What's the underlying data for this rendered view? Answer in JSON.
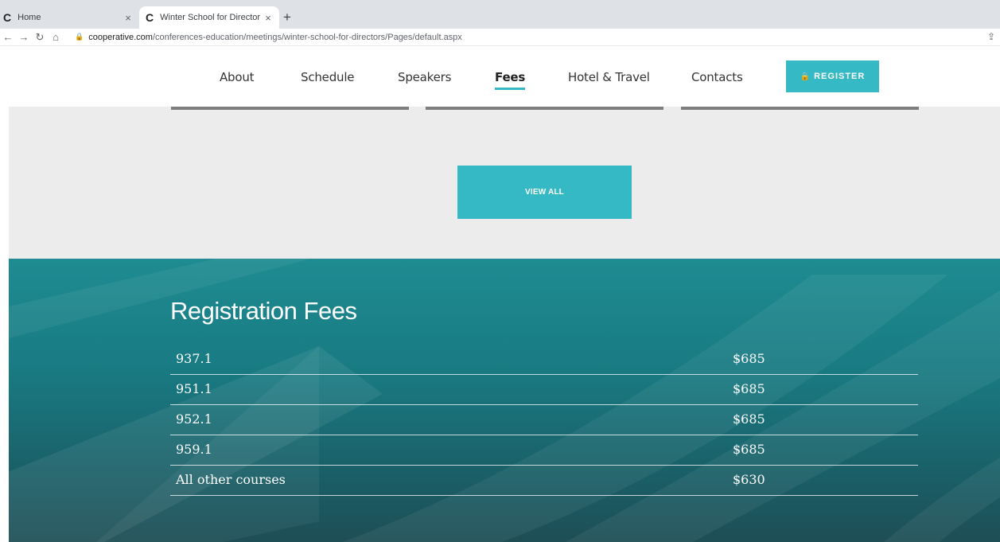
{
  "browser": {
    "tabs": [
      {
        "label": "Home",
        "favicon": "C",
        "close": "×"
      },
      {
        "label": "Winter School for Directors",
        "favicon": "C",
        "close": "×"
      }
    ],
    "new_tab": "+",
    "url_host": "cooperative.com",
    "url_path": "/conferences-education/meetings/winter-school-for-directors/Pages/default.aspx"
  },
  "nav": {
    "links": [
      "About",
      "Schedule",
      "Speakers",
      "Fees",
      "Hotel & Travel",
      "Contacts"
    ],
    "active": "Fees",
    "register_label": "REGISTER"
  },
  "gray_section": {
    "view_all_label": "VIEW ALL"
  },
  "fees": {
    "title": "Registration Fees",
    "rows": [
      {
        "course": "937.1",
        "price": "$685"
      },
      {
        "course": "951.1",
        "price": "$685"
      },
      {
        "course": "952.1",
        "price": "$685"
      },
      {
        "course": "959.1",
        "price": "$685"
      },
      {
        "course": "All other courses",
        "price": "$630"
      }
    ]
  },
  "colors": {
    "accent": "#35b9c4",
    "teal_bg": "#1a7a82",
    "gray_bg": "#ececec",
    "card_bar": "#7e7e7e"
  }
}
